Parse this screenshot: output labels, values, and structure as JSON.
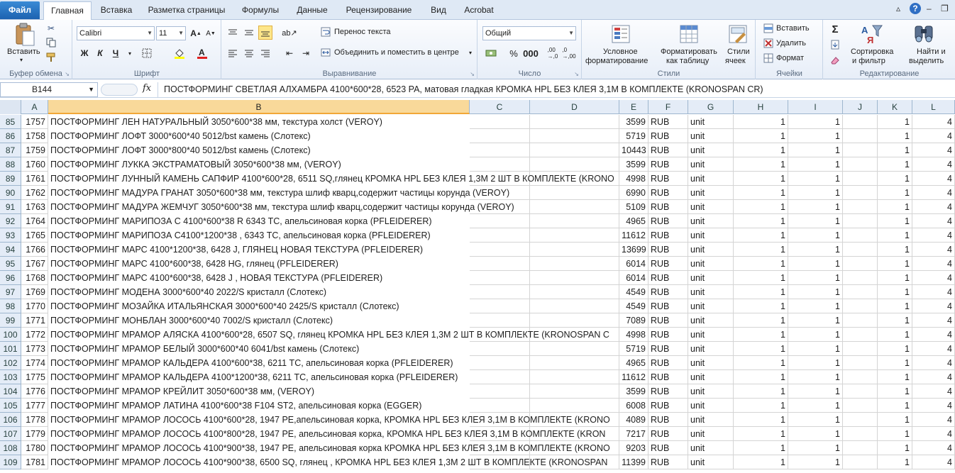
{
  "tabs": {
    "file": "Файл",
    "items": [
      "Главная",
      "Вставка",
      "Разметка страницы",
      "Формулы",
      "Данные",
      "Рецензирование",
      "Вид",
      "Acrobat"
    ]
  },
  "ribbon": {
    "clipboard": {
      "paste": "Вставить",
      "label": "Буфер обмена"
    },
    "font": {
      "name": "Calibri",
      "size": "11",
      "label": "Шрифт"
    },
    "alignment": {
      "wrap": "Перенос текста",
      "merge": "Объединить и поместить в центре",
      "label": "Выравнивание"
    },
    "number": {
      "format": "Общий",
      "label": "Число"
    },
    "styles": {
      "cond1": "Условное",
      "cond2": "форматирование",
      "table1": "Форматировать",
      "table2": "как таблицу",
      "cell1": "Стили",
      "cell2": "ячеек",
      "label": "Стили"
    },
    "cells": {
      "insert": "Вставить",
      "delete": "Удалить",
      "format": "Формат",
      "label": "Ячейки"
    },
    "editing": {
      "sort1": "Сортировка",
      "sort2": "и фильтр",
      "find1": "Найти и",
      "find2": "выделить",
      "label": "Редактирование"
    }
  },
  "formula_bar": {
    "cell_ref": "B144",
    "fx": "fx",
    "formula": "ПОСТФОРМИНГ СВЕТЛАЯ АЛХАМБРА 4100*600*28, 6523 PA, матовая гладкая КРОМКА HPL БЕЗ КЛЕЯ 3,1М В КОМПЛЕКТЕ (KRONOSPAN CR)"
  },
  "columns": [
    "A",
    "B",
    "C",
    "D",
    "E",
    "F",
    "G",
    "H",
    "I",
    "J",
    "K",
    "L"
  ],
  "rows": [
    {
      "n": "85",
      "a": "1757",
      "b": "ПОСТФОРМИНГ ЛЕН НАТУРАЛЬНЫЙ 3050*600*38 мм, текстура холст (VEROY)",
      "e": "3599"
    },
    {
      "n": "86",
      "a": "1758",
      "b": "ПОСТФОРМИНГ ЛОФТ 3000*600*40 5012/bst камень (Слотекс)",
      "e": "5719"
    },
    {
      "n": "87",
      "a": "1759",
      "b": "ПОСТФОРМИНГ ЛОФТ 3000*800*40 5012/bst камень (Слотекс)",
      "e": "10443"
    },
    {
      "n": "88",
      "a": "1760",
      "b": "ПОСТФОРМИНГ ЛУККА ЭКСТРАМАТОВЫЙ 3050*600*38 мм, (VEROY)",
      "e": "3599"
    },
    {
      "n": "89",
      "a": "1761",
      "b": "ПОСТФОРМИНГ ЛУННЫЙ КАМЕНЬ САПФИР 4100*600*28, 6511 SQ,глянец КРОМКА HPL БЕЗ КЛЕЯ 1,3М 2 ШТ В КОМПЛЕКТЕ (KRONO",
      "e": "4998"
    },
    {
      "n": "90",
      "a": "1762",
      "b": "ПОСТФОРМИНГ МАДУРА ГРАНАТ 3050*600*38 мм, текстура шлиф кварц,содержит частицы корунда  (VEROY)",
      "e": "6990"
    },
    {
      "n": "91",
      "a": "1763",
      "b": "ПОСТФОРМИНГ МАДУРА ЖЕМЧУГ 3050*600*38 мм, текстура шлиф кварц,содержит частицы корунда  (VEROY)",
      "e": "5109"
    },
    {
      "n": "92",
      "a": "1764",
      "b": "ПОСТФОРМИНГ МАРИПОЗА С 4100*600*38 R 6343 TC, апельсиновая корка (PFLEIDERER)",
      "e": "4965"
    },
    {
      "n": "93",
      "a": "1765",
      "b": "ПОСТФОРМИНГ МАРИПОЗА С4100*1200*38 , 6343 TC, апельсиновая корка (PFLEIDERER)",
      "e": "11612"
    },
    {
      "n": "94",
      "a": "1766",
      "b": "ПОСТФОРМИНГ МАРС 4100*1200*38, 6428 J, ГЛЯНЕЦ НОВАЯ ТЕКСТУРА (PFLEIDERER)",
      "e": "13699"
    },
    {
      "n": "95",
      "a": "1767",
      "b": "ПОСТФОРМИНГ МАРС 4100*600*38, 6428 HG, глянец (PFLEIDERER)",
      "e": "6014"
    },
    {
      "n": "96",
      "a": "1768",
      "b": "ПОСТФОРМИНГ МАРС 4100*600*38, 6428 J , НОВАЯ ТЕКСТУРА (PFLEIDERER)",
      "e": "6014"
    },
    {
      "n": "97",
      "a": "1769",
      "b": "ПОСТФОРМИНГ МОДЕНА 3000*600*40 2022/S кристалл (Слотекс)",
      "e": "4549"
    },
    {
      "n": "98",
      "a": "1770",
      "b": "ПОСТФОРМИНГ МОЗАЙКА ИТАЛЬЯНСКАЯ  3000*600*40 2425/S кристалл (Слотекс)",
      "e": "4549"
    },
    {
      "n": "99",
      "a": "1771",
      "b": "ПОСТФОРМИНГ МОНБЛАН 3000*600*40 7002/S кристалл (Слотекс)",
      "e": "7089"
    },
    {
      "n": "100",
      "a": "1772",
      "b": "ПОСТФОРМИНГ МРАМОР АЛЯСКА 4100*600*28, 6507 SQ, глянец КРОМКА HPL БЕЗ КЛЕЯ 1,3М 2 ШТ В КОМПЛЕКТЕ (KRONOSPAN C",
      "e": "4998"
    },
    {
      "n": "101",
      "a": "1773",
      "b": "ПОСТФОРМИНГ МРАМОР БЕЛЫЙ 3000*600*40 6041/bst камень (Слотекс)",
      "e": "5719"
    },
    {
      "n": "102",
      "a": "1774",
      "b": "ПОСТФОРМИНГ МРАМОР КАЛЬДЕРА 4100*600*38, 6211 TC, апельсиновая корка (PFLEIDERER)",
      "e": "4965"
    },
    {
      "n": "103",
      "a": "1775",
      "b": "ПОСТФОРМИНГ МРАМОР КАЛЬДЕРА 4100*1200*38, 6211 TC, апельсиновая корка (PFLEIDERER)",
      "e": "11612"
    },
    {
      "n": "104",
      "a": "1776",
      "b": "ПОСТФОРМИНГ МРАМОР КРЕЙЛИТ 3050*600*38 мм, (VEROY)",
      "e": "3599"
    },
    {
      "n": "105",
      "a": "1777",
      "b": "ПОСТФОРМИНГ МРАМОР ЛАТИНА 4100*600*38 F104 ST2, апельсиновая корка (EGGER)",
      "e": "6008"
    },
    {
      "n": "106",
      "a": "1778",
      "b": "ПОСТФОРМИНГ МРАМОР ЛОСОСЬ 4100*600*28, 1947 PE,апельсиновая корка, КРОМКА HPL БЕЗ КЛЕЯ 3,1М В КОМПЛЕКТЕ (KRONO",
      "e": "4089"
    },
    {
      "n": "107",
      "a": "1779",
      "b": "ПОСТФОРМИНГ МРАМОР ЛОСОСЬ 4100*800*28, 1947 PE, апельсиновая корка, КРОМКА HPL БЕЗ КЛЕЯ 3,1М В КОМПЛЕКТЕ (KRON",
      "e": "7217"
    },
    {
      "n": "108",
      "a": "1780",
      "b": "ПОСТФОРМИНГ МРАМОР ЛОСОСЬ 4100*900*38, 1947 PE, апельсиновая корка КРОМКА HPL БЕЗ КЛЕЯ 3,1М В КОМПЛЕКТЕ (KRONO",
      "e": "9203"
    },
    {
      "n": "109",
      "a": "1781",
      "b": "ПОСТФОРМИНГ МРАМОР ЛОСОСЬ 4100*900*38, 6500 SQ, глянец , КРОМКА HPL БЕЗ КЛЕЯ 1,3М 2 ШТ В КОМПЛЕКТЕ (KRONOSPAN",
      "e": "11399"
    }
  ],
  "common": {
    "f": "RUB",
    "g": "unit",
    "h": "1",
    "i": "1",
    "k": "1",
    "l": "4"
  }
}
